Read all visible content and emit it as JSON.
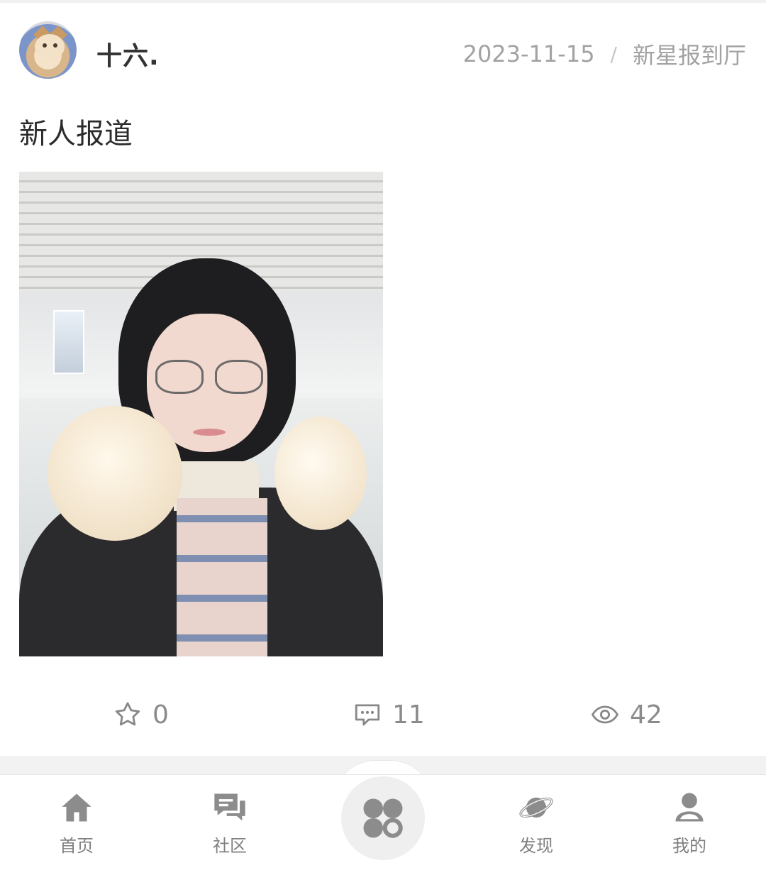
{
  "post": {
    "author": "十六.",
    "date": "2023-11-15",
    "separator": "/",
    "board": "新星报到厅",
    "title": "新人报道"
  },
  "stats": {
    "likes": "0",
    "comments": "11",
    "views": "42"
  },
  "icons": {
    "like": "star-icon",
    "comment": "comment-icon",
    "view": "eye-icon",
    "home": "home-icon",
    "community": "chat-icon",
    "center": "grid-icon",
    "discover": "planet-icon",
    "me": "user-icon"
  },
  "nav": {
    "home": "首页",
    "community": "社区",
    "discover": "发现",
    "me": "我的"
  },
  "colors": {
    "icon_gray": "#888888",
    "text_gray": "#a2a2a2",
    "title": "#2b2b2b"
  }
}
